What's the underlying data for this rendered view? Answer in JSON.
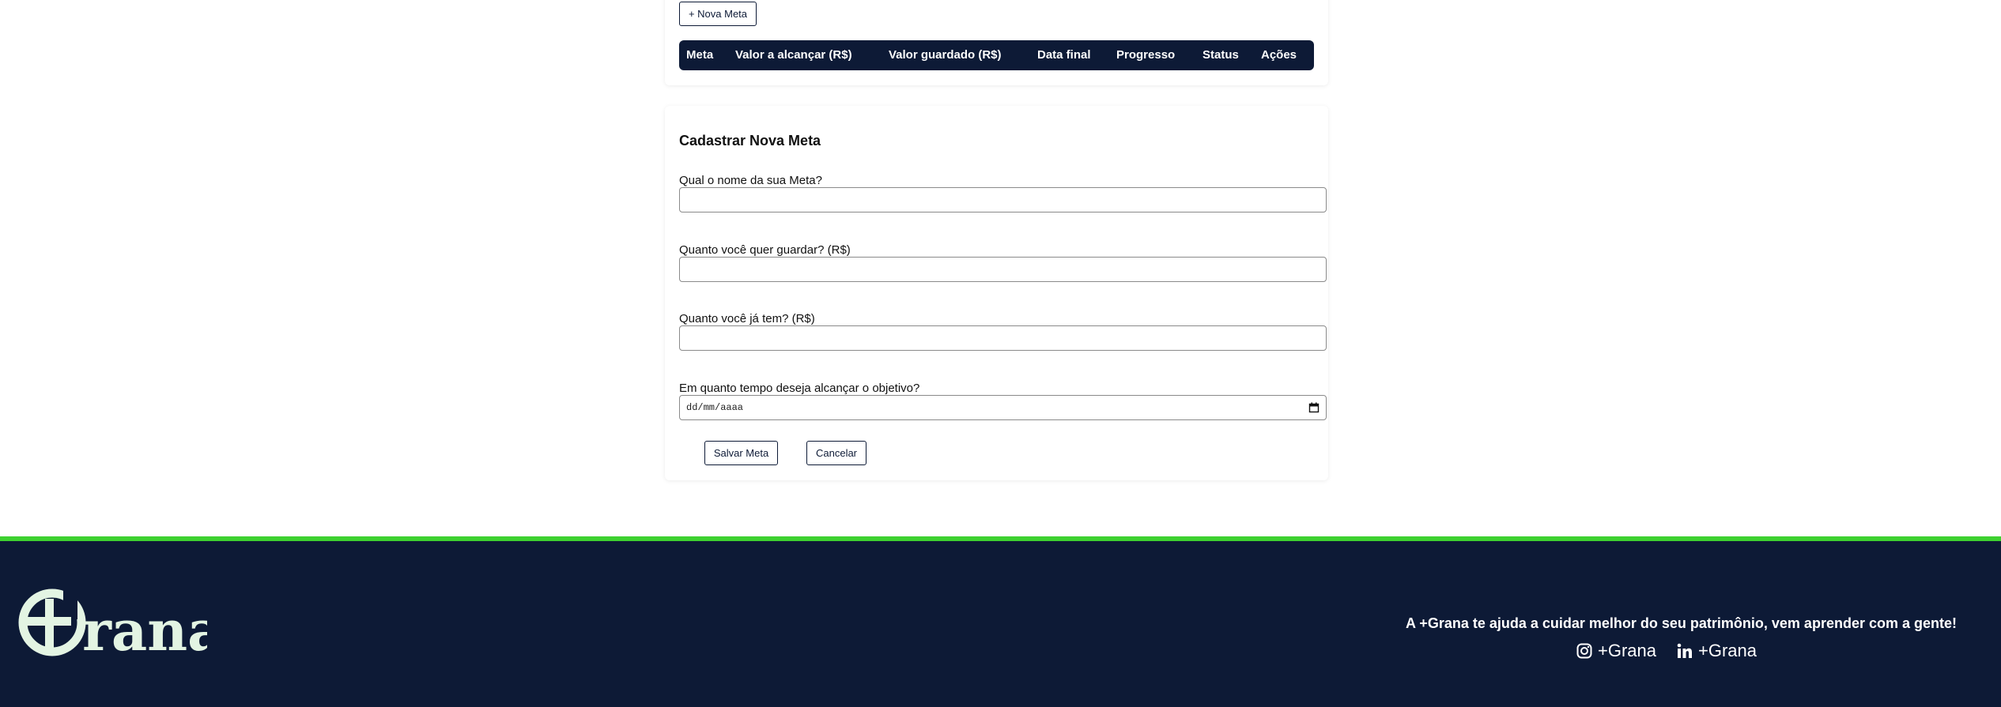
{
  "goals": {
    "new_goal_button": "+ Nova Meta",
    "columns": [
      "Meta",
      "Valor a alcançar (R$)",
      "Valor guardado (R$)",
      "Data final",
      "Progresso",
      "Status",
      "Ações"
    ]
  },
  "form": {
    "title": "Cadastrar Nova Meta",
    "name_label": "Qual o nome da sua Meta?",
    "name_value": "",
    "target_label": "Quanto você quer guardar? (R$)",
    "target_value": "",
    "current_label": "Quanto você já tem? (R$)",
    "current_value": "",
    "deadline_label": "Em quanto tempo deseja alcançar o objetivo?",
    "deadline_placeholder": "dd/mm/aaaa",
    "save_button": "Salvar Meta",
    "cancel_button": "Cancelar"
  },
  "footer": {
    "logo_text": "Grana",
    "tagline": "A +Grana te ajuda a cuidar melhor do seu patrimônio, vem aprender com a gente!",
    "instagram_label": "+Grana",
    "linkedin_label": "+Grana"
  },
  "colors": {
    "navy": "#0d1a36",
    "green_accent": "#3ed130",
    "logo_cream": "#e3f4e3"
  },
  "icons": [
    "instagram-icon",
    "linkedin-icon",
    "calendar-icon"
  ]
}
